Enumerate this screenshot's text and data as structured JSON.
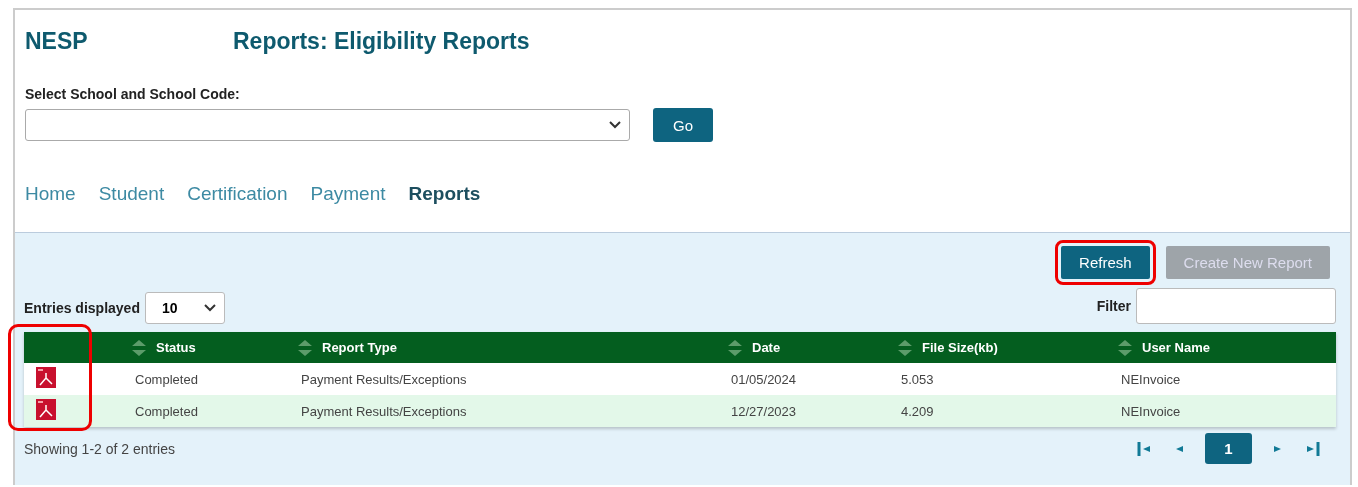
{
  "app_name": "NESP",
  "page_title": "Reports: Eligibility Reports",
  "school_select": {
    "label": "Select School and School Code:"
  },
  "go_button": "Go",
  "tabs": [
    {
      "label": "Home",
      "selected": false
    },
    {
      "label": "Student",
      "selected": false
    },
    {
      "label": "Certification",
      "selected": false
    },
    {
      "label": "Payment",
      "selected": false
    },
    {
      "label": "Reports",
      "selected": true
    }
  ],
  "actions": [
    {
      "label": "Refresh",
      "disabled": false,
      "highlighted": true
    },
    {
      "label": "Create New Report",
      "disabled": true,
      "highlighted": false
    }
  ],
  "entries": {
    "label": "Entries displayed",
    "value": "10"
  },
  "filter": {
    "label": "Filter"
  },
  "table": {
    "icon_column_highlighted": true,
    "columns": [
      {
        "label": "Status"
      },
      {
        "label": "Report Type"
      },
      {
        "label": "Date"
      },
      {
        "label": "File Size(kb)"
      },
      {
        "label": "User Name"
      }
    ],
    "rows": [
      {
        "status": "Completed",
        "report_type": "Payment Results/Exceptions",
        "date": "01/05/2024",
        "file_size": "5.053",
        "user_name": "NEInvoice"
      },
      {
        "status": "Completed",
        "report_type": "Payment Results/Exceptions",
        "date": "12/27/2023",
        "file_size": "4.209",
        "user_name": "NEInvoice"
      }
    ]
  },
  "summary": "Showing 1-2 of 2 entries",
  "pagination": {
    "pages": [
      {
        "label": "1",
        "selected": true
      }
    ]
  }
}
